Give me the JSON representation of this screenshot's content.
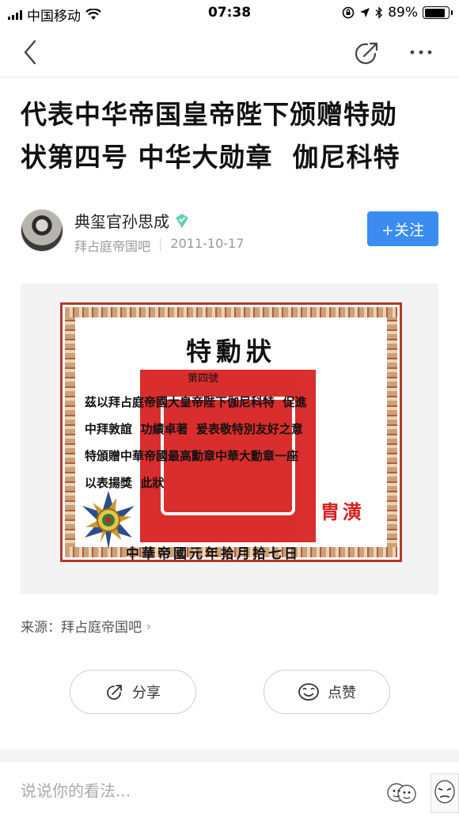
{
  "status_bar": {
    "carrier": "中国移动",
    "time": "07:38",
    "battery": "89%",
    "battery_level": 0.89
  },
  "article": {
    "title_line1": "代表中华帝国皇帝陛下颁赠特勋",
    "title_line2": "状第四号 中华大勋章  伽尼科特",
    "author": {
      "name": "典玺官孙思成",
      "forum": "拜占庭帝国吧",
      "date": "2011-10-17",
      "follow_label": "+关注"
    },
    "certificate": {
      "title": "特勳狀",
      "number": "第四號",
      "line1": "茲以拜占庭帝國大皇帝陛下伽尼科特  促進",
      "line2": "中拜敦誼  功績卓著  爰表敬特別友好之意",
      "line3": "特頒贈中華帝國最高勳章中華大勳章一座",
      "line4": "以表揚獎  此狀",
      "signature": "胄潢",
      "date": "中華帝國元年拾月拾七日"
    },
    "source_label": "来源：拜占庭帝国吧",
    "share_label": "分享",
    "like_label": "点赞"
  },
  "comment": {
    "placeholder": "说说你的看法..."
  },
  "colors": {
    "accent": "#3b8cf0",
    "seal_red": "#d81e1e"
  },
  "icons": [
    "back-icon",
    "share-icon",
    "more-icon",
    "verified-icon",
    "like-icon",
    "emoji-icon"
  ]
}
